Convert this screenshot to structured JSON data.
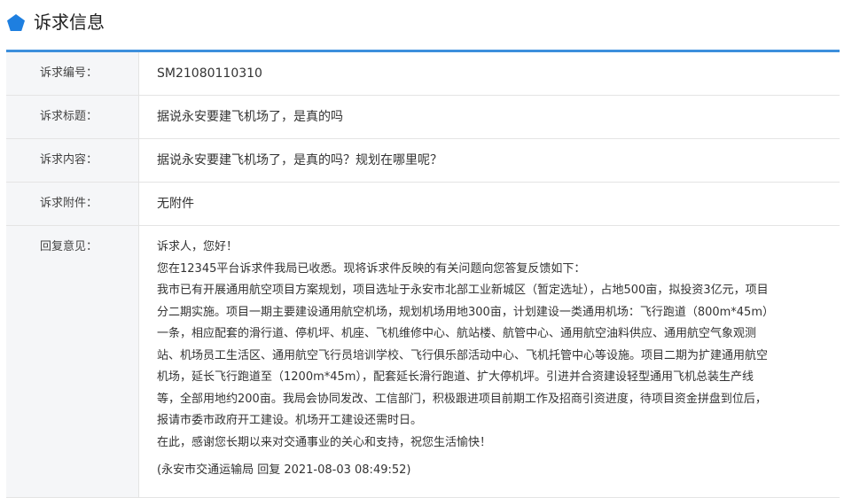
{
  "header": {
    "title": "诉求信息",
    "icon": "pentagon-icon",
    "accent_color": "#1e7fe0"
  },
  "fields": {
    "number_label": "诉求编号：",
    "number_value": "SM21080110310",
    "title_label": "诉求标题：",
    "title_value": "据说永安要建飞机场了，是真的吗",
    "content_label": "诉求内容：",
    "content_value": "据说永安要建飞机场了，是真的吗？规划在哪里呢？",
    "attachment_label": "诉求附件：",
    "attachment_value": "无附件",
    "reply_label": "回复意见："
  },
  "reply": {
    "lines": [
      "诉求人，您好！",
      "您在12345平台诉求件我局已收悉。现将诉求件反映的有关问题向您答复反馈如下：",
      "我市已有开展通用航空项目方案规划，项目选址于永安市北部工业新城区（暂定选址），占地500亩，拟投资3亿元，项目",
      "分二期实施。项目一期主要建设通用航空机场，规划机场用地300亩，计划建设一类通用机场：飞行跑道（800m*45m）",
      "一条，相应配套的滑行道、停机坪、机座、飞机维修中心、航站楼、航管中心、通用航空油料供应、通用航空气象观测",
      "站、机场员工生活区、通用航空飞行员培训学校、飞行俱乐部活动中心、飞机托管中心等设施。项目二期为扩建通用航空",
      "机场，延长飞行跑道至（1200m*45m），配套延长滑行跑道、扩大停机坪。引进并合资建设轻型通用飞机总装生产线",
      "等，全部用地约200亩。我局会协同发改、工信部门，积极跟进项目前期工作及招商引资进度，待项目资金拼盘到位后，",
      "报请市委市政府开工建设。机场开工建设还需时日。",
      "在此，感谢您长期以来对交通事业的关心和支持，祝您生活愉快！"
    ],
    "signature": "(永安市交通运输局 回复 2021-08-03 08:49:52)"
  }
}
